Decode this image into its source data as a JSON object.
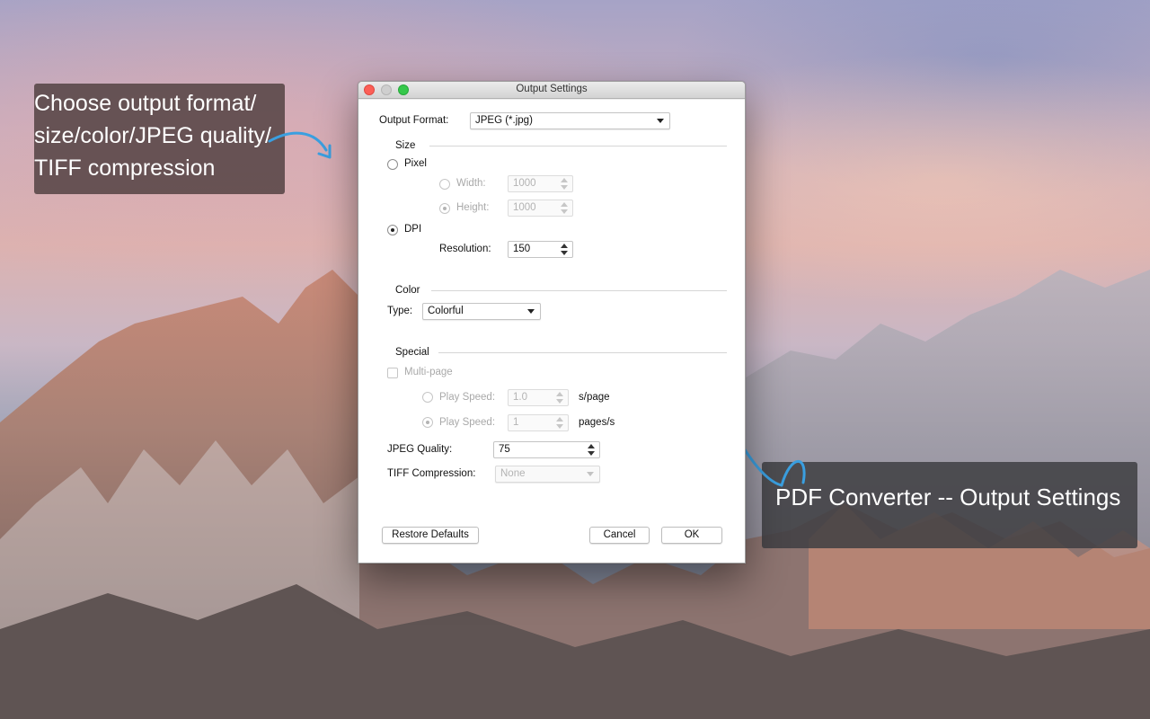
{
  "callouts": {
    "left_lines": [
      "Choose output format/",
      "size/color/JPEG quality/",
      "TIFF compression"
    ],
    "right": "PDF Converter -- Output Settings",
    "arrow_color": "#3a9fe0"
  },
  "window": {
    "title": "Output Settings"
  },
  "output_format": {
    "label": "Output Format:",
    "value": "JPEG (*.jpg)"
  },
  "size": {
    "title": "Size",
    "pixel_label": "Pixel",
    "pixel_selected": false,
    "width_label": "Width:",
    "width_value": "1000",
    "height_label": "Height:",
    "height_value": "1000",
    "dpi_label": "DPI",
    "dpi_selected": true,
    "resolution_label": "Resolution:",
    "resolution_value": "150"
  },
  "color": {
    "title": "Color",
    "type_label": "Type:",
    "type_value": "Colorful"
  },
  "special": {
    "title": "Special",
    "multipage_label": "Multi-page",
    "play_speed_label_1": "Play Speed:",
    "play_speed_value_1": "1.0",
    "play_speed_unit_1": "s/page",
    "play_speed_label_2": "Play Speed:",
    "play_speed_value_2": "1",
    "play_speed_unit_2": "pages/s",
    "jpeg_quality_label": "JPEG Quality:",
    "jpeg_quality_value": "75",
    "tiff_label": "TIFF Compression:",
    "tiff_value": "None"
  },
  "buttons": {
    "restore": "Restore Defaults",
    "cancel": "Cancel",
    "ok": "OK"
  }
}
